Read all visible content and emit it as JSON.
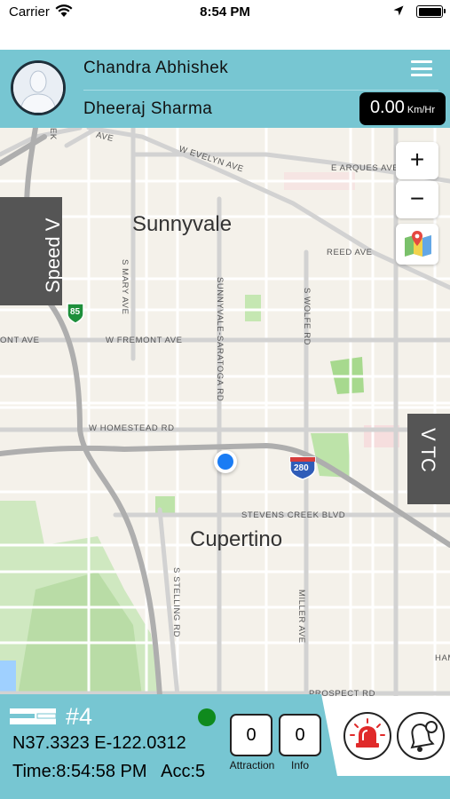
{
  "status_bar": {
    "carrier": "Carrier",
    "time": "8:54 PM"
  },
  "header": {
    "driver_name": "Chandra  Abhishek",
    "co_driver_name": "Dheeraj  Sharma",
    "speed_value": "0.00",
    "speed_unit": "Km/Hr"
  },
  "map": {
    "zoom_in_label": "+",
    "zoom_out_label": "−",
    "speed_tab_label": "Speed V",
    "tc_tab_label": "V TC",
    "cities": [
      "Sunnyvale",
      "Cupertino"
    ],
    "streets": {
      "evelyn": "W EVELYN AVE",
      "arques": "E ARQUES AVE",
      "reed": "REED AVE",
      "mary": "S MARY AVE",
      "wolfe": "S WOLFE RD",
      "saratoga": "SUNNYVALE-SARATOGA RD",
      "fremont": "W FREMONT AVE",
      "fremont_left": "ONT AVE",
      "homestead": "W HOMESTEAD RD",
      "stevens": "STEVENS CREEK BLVD",
      "stelling": "S STELLING RD",
      "miller": "MILLER AVE",
      "prospect": "PROSPECT RD",
      "ham": "HAM",
      "top_left": "EK",
      "top_ave": "AVE"
    },
    "shields": {
      "hwy85": "85",
      "i280": "280"
    }
  },
  "bottom": {
    "vehicle_number": "#4",
    "coordinates": "N37.3323 E-122.0312",
    "time_line": "Time:8:54:58 PM   Acc:5",
    "attraction_count": "0",
    "attraction_label": "Attraction",
    "info_count": "0",
    "info_label": "Info",
    "colors": {
      "panel": "#77c6d2",
      "gps_status": "#0f8a1d"
    }
  }
}
